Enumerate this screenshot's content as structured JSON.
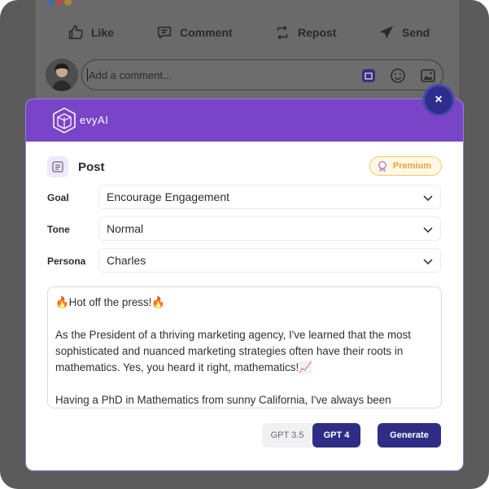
{
  "feed": {
    "actions": [
      {
        "label": "Like",
        "icon": "thumbs-up-icon"
      },
      {
        "label": "Comment",
        "icon": "comment-icon"
      },
      {
        "label": "Repost",
        "icon": "repost-icon"
      },
      {
        "label": "Send",
        "icon": "send-icon"
      }
    ],
    "comment_placeholder": "Add a comment..."
  },
  "modal": {
    "brand": "evyAI",
    "section_title": "Post",
    "premium_badge": "Premium",
    "fields": [
      {
        "label": "Goal",
        "value": "Encourage Engagement"
      },
      {
        "label": "Tone",
        "value": "Normal"
      },
      {
        "label": "Persona",
        "value": "Charles"
      }
    ],
    "generated_text": [
      "🔥Hot off the press!🔥",
      "",
      "As the President of a thriving marketing agency, I've learned that the most sophisticated and nuanced marketing strategies often have their roots in mathematics. Yes, you heard it right, mathematics!📈",
      "",
      "Having a PhD in Mathematics from sunny California, I've always been"
    ],
    "model_options": [
      "GPT 3.5",
      "GPT 4"
    ],
    "selected_model": "GPT 4",
    "generate_label": "Generate",
    "close_label": "×"
  },
  "colors": {
    "header_purple": "#7a44c8",
    "navy": "#2f2c86",
    "premium_text": "#e7a23a",
    "overlay": "#5b5b5b"
  }
}
